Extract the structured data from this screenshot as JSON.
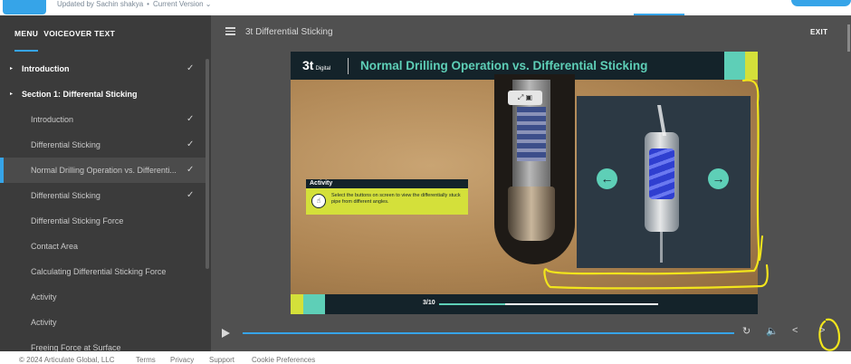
{
  "top": {
    "updated_by": "Updated by Sachin shakya",
    "version": "Current Version"
  },
  "sidebar": {
    "tabs": [
      "MENU",
      "VOICEOVER TEXT"
    ],
    "items": [
      {
        "label": "Introduction",
        "checked": true,
        "level": "top"
      },
      {
        "label": "Section 1: Differental Sticking",
        "checked": false,
        "level": "top"
      },
      {
        "label": "Introduction",
        "checked": true,
        "level": "sub"
      },
      {
        "label": "Differential Sticking",
        "checked": true,
        "level": "sub"
      },
      {
        "label": "Normal Drilling Operation vs. Differenti...",
        "checked": true,
        "level": "sub",
        "active": true
      },
      {
        "label": "Differential Sticking",
        "checked": true,
        "level": "sub"
      },
      {
        "label": "Differential Sticking Force",
        "checked": false,
        "level": "sub"
      },
      {
        "label": "Contact Area",
        "checked": false,
        "level": "sub"
      },
      {
        "label": "Calculating Differential Sticking Force",
        "checked": false,
        "level": "sub"
      },
      {
        "label": "Activity",
        "checked": false,
        "level": "sub"
      },
      {
        "label": "Activity",
        "checked": false,
        "level": "sub"
      },
      {
        "label": "Freeing Force at Surface",
        "checked": false,
        "level": "sub"
      }
    ],
    "check_glyph": "✓",
    "caret_glyph": "▸"
  },
  "player": {
    "course_title": "3t Differential Sticking",
    "exit_label": "EXIT"
  },
  "slide": {
    "logo": "3t",
    "logo_sub": "Digital",
    "title": "Normal Drilling Operation vs. Differential Sticking",
    "activity_title": "Activity",
    "activity_text": "Select the buttons on screen to view the differentially stuck pipe from different angles.",
    "counter": "3/10",
    "progress": 0.3,
    "left_arrow": "←",
    "right_arrow": "→"
  },
  "footer": {
    "copyright": "© 2024 Articulate Global, LLC",
    "links": [
      "Terms",
      "Privacy",
      "Support",
      "Cookie Preferences"
    ]
  },
  "colors": {
    "accent": "#36a4e8",
    "teal": "#5ecfb7",
    "lime": "#d4e03a",
    "annotation": "#f2e51c"
  }
}
